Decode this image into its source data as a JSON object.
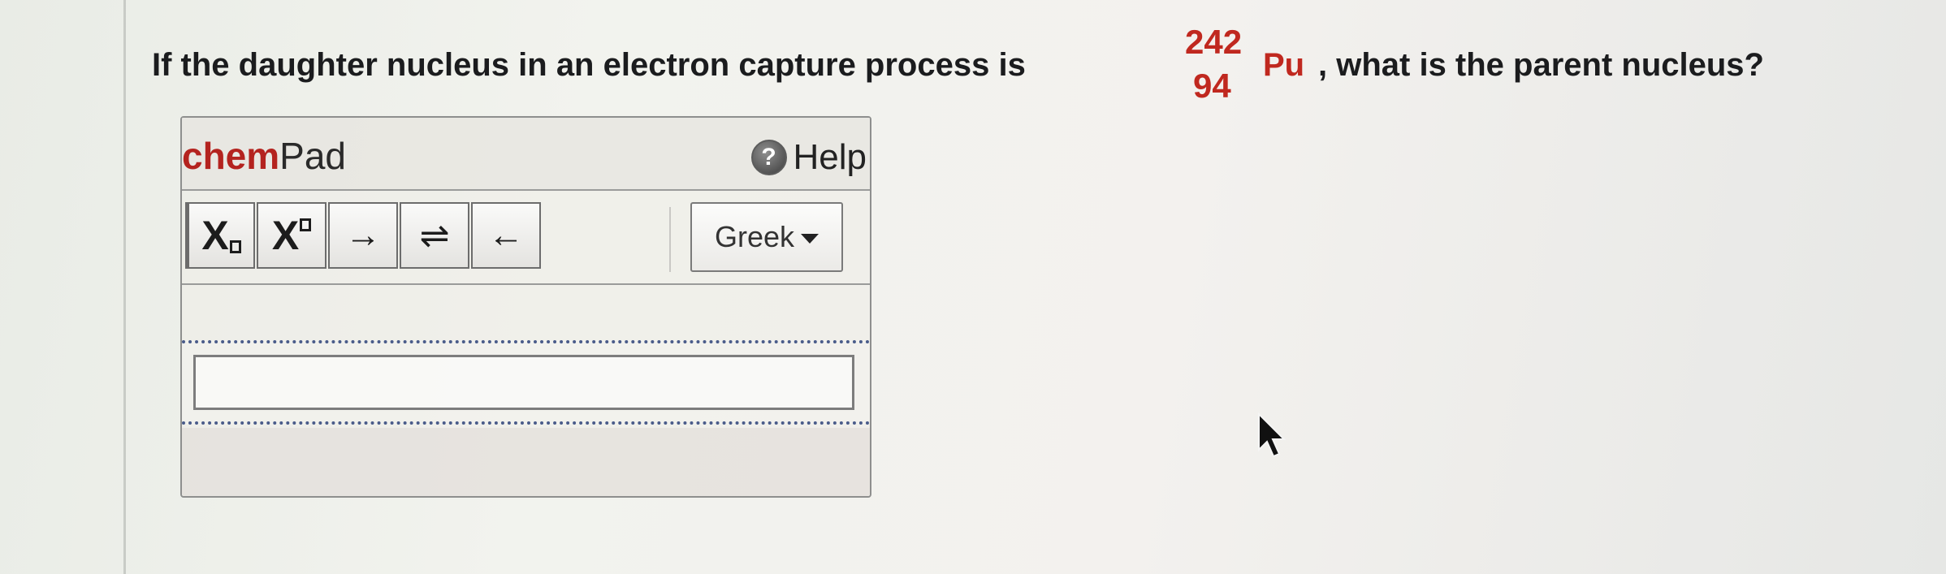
{
  "question": {
    "prefix": "If the daughter nucleus in an electron capture process is",
    "nuclide": {
      "mass_number": "242",
      "atomic_number": "94",
      "symbol": "Pu"
    },
    "suffix": ", what is the parent nucleus?"
  },
  "chempad": {
    "title_chem": "chem",
    "title_pad": "Pad",
    "help_icon": "?",
    "help_label": "Help",
    "toolbar": {
      "subscript_label": "X",
      "superscript_label": "X",
      "arrow_right": "→",
      "equilibrium": "⇌",
      "arrow_left": "←",
      "greek_label": "Greek"
    },
    "input_value": ""
  },
  "colors": {
    "accent_red": "#c0281f",
    "focus_dotted": "#4a5c8a"
  },
  "icons": {
    "help": "help-circle-icon",
    "greek_dropdown": "caret-down-icon",
    "cursor": "mouse-pointer-icon"
  }
}
